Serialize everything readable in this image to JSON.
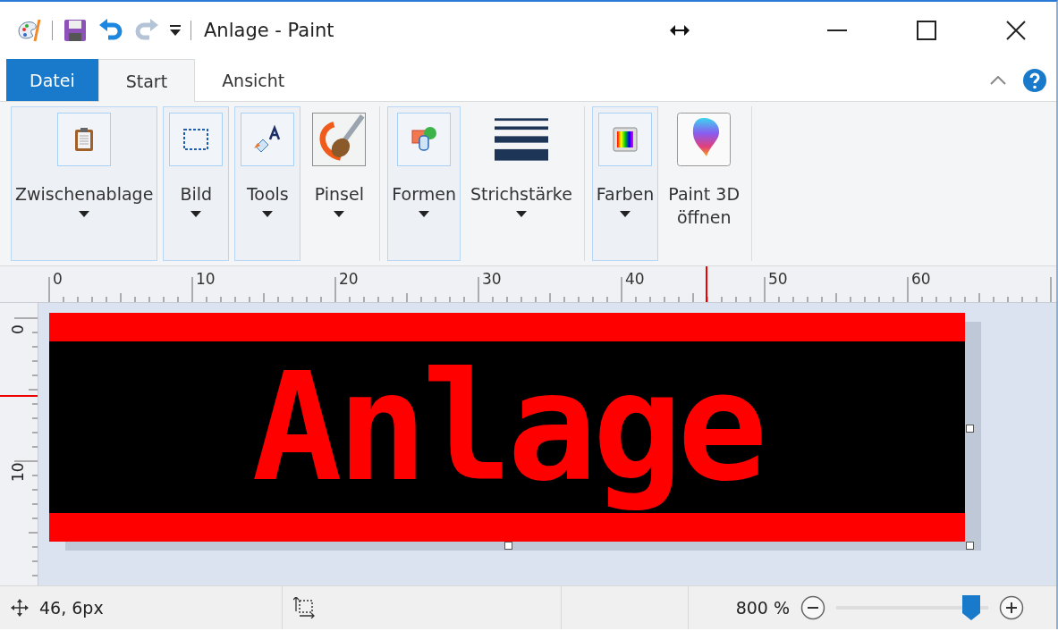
{
  "title_bar": {
    "title": "Anlage - Paint"
  },
  "tabs": [
    {
      "label": "Datei",
      "kind": "file",
      "selected": false
    },
    {
      "label": "Start",
      "kind": "tab",
      "selected": true
    },
    {
      "label": "Ansicht",
      "kind": "tab",
      "selected": false
    }
  ],
  "ribbon": {
    "sections": [
      {
        "groups": [
          {
            "label": "Zwischenablage",
            "kind": "clipboard",
            "collapsed": true,
            "dropdown": true
          },
          {
            "label": "Bild",
            "kind": "image",
            "collapsed": true,
            "dropdown": true
          },
          {
            "label": "Tools",
            "kind": "tools",
            "collapsed": true,
            "dropdown": true
          },
          {
            "label": "Pinsel",
            "kind": "brushes",
            "collapsed": false,
            "dropdown": true
          }
        ]
      },
      {
        "groups": [
          {
            "label": "Formen",
            "kind": "shapes",
            "collapsed": true,
            "dropdown": true
          },
          {
            "label": "Strichstärke",
            "kind": "size",
            "collapsed": false,
            "dropdown": true
          }
        ]
      },
      {
        "groups": [
          {
            "label": "Farben",
            "kind": "colors",
            "collapsed": true,
            "dropdown": true
          },
          {
            "label": "Paint 3D\nöffnen",
            "kind": "paint3d",
            "collapsed": false,
            "dropdown": false
          }
        ]
      }
    ]
  },
  "ruler": {
    "horizontal": [
      "0",
      "10",
      "20",
      "30",
      "40",
      "50",
      "60"
    ],
    "vertical": [
      "0",
      "10"
    ]
  },
  "canvas": {
    "text": "Anlage"
  },
  "status_bar": {
    "position": "46, 6px",
    "zoom": "800 %",
    "zoom_slider": {
      "level": 0.94
    }
  }
}
